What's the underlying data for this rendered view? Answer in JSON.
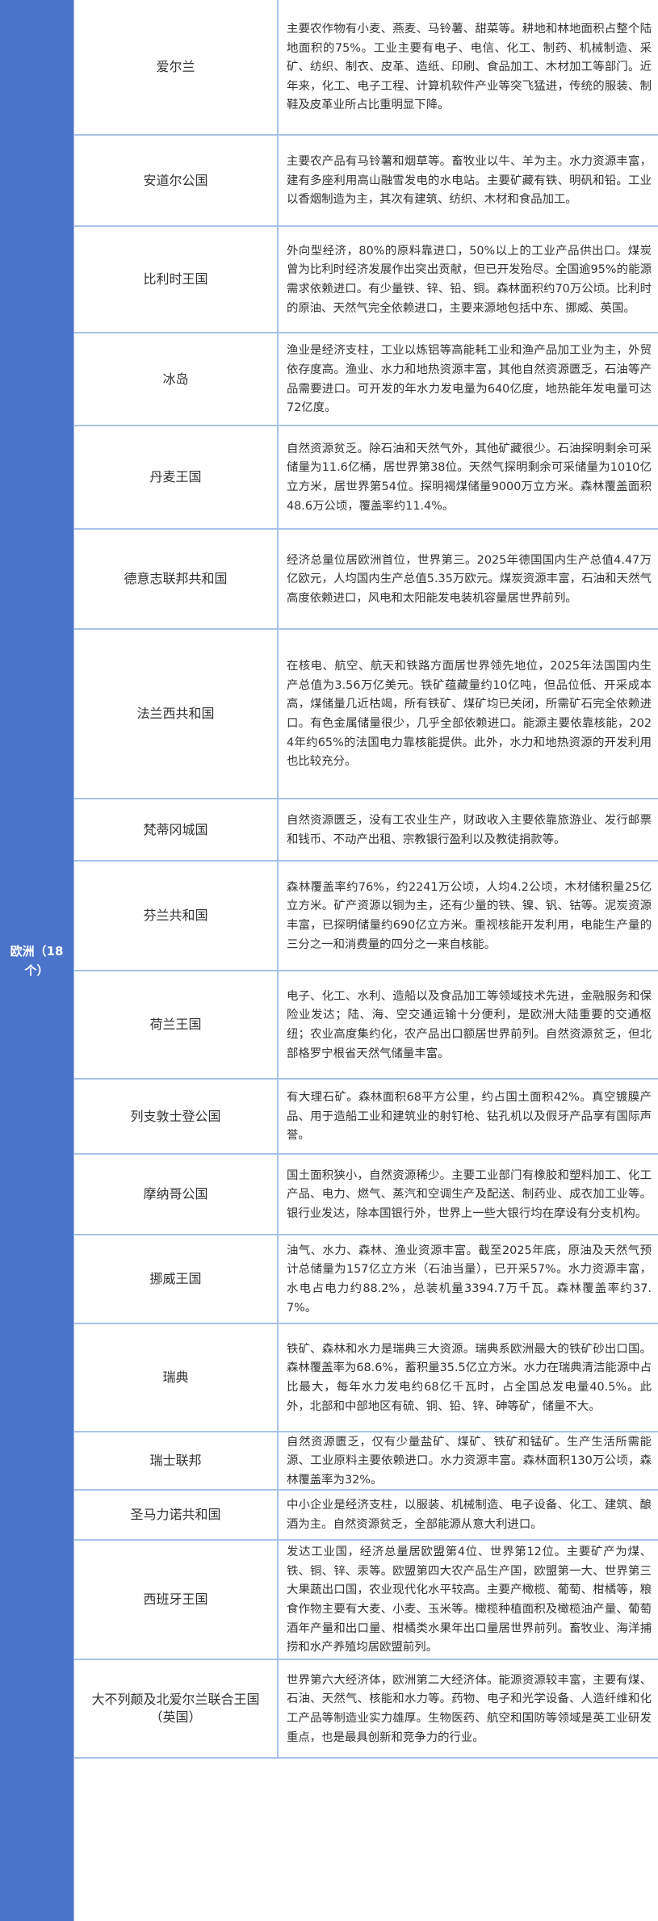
{
  "region_label": "欧洲（18个）",
  "countries": [
    {
      "name": "爱尔兰",
      "desc": "主要农作物有小麦、燕麦、马铃薯、甜菜等。耕地和林地面积占整个陆地面积的75%。工业主要有电子、电信、化工、制药、机械制造、采矿、纺织、制衣、皮革、造纸、印刷、食品加工、木材加工等部门。近年来，化工、电子工程、计算机软件产业等突飞猛进，传统的服装、制鞋及皮革业所占比重明显下降。"
    },
    {
      "name": "安道尔公国",
      "desc": "主要农产品有马铃薯和烟草等。畜牧业以牛、羊为主。水力资源丰富，建有多座利用高山融雪发电的水电站。主要矿藏有铁、明矾和铅。工业以香烟制造为主，其次有建筑、纺织、木材和食品加工。"
    },
    {
      "name": "比利时王国",
      "desc": "外向型经济，80%的原料靠进口，50%以上的工业产品供出口。煤炭曾为比利时经济发展作出突出贡献，但已开发殆尽。全国逾95%的能源需求依赖进口。有少量铁、锌、铅、铜。森林面积约70万公顷。比利时的原油、天然气完全依赖进口，主要来源地包括中东、挪威、英国。"
    },
    {
      "name": "冰岛",
      "desc": "渔业是经济支柱，工业以炼铝等高能耗工业和渔产品加工业为主，外贸依存度高。渔业、水力和地热资源丰富，其他自然资源匮乏，石油等产品需要进口。可开发的年水力发电量为640亿度，地热能年发电量可达72亿度。"
    },
    {
      "name": "丹麦王国",
      "desc": "自然资源贫乏。除石油和天然气外，其他矿藏很少。石油探明剩余可采储量为11.6亿桶，居世界第38位。天然气探明剩余可采储量为1010亿立方米，居世界第54位。探明褐煤储量9000万立方米。森林覆盖面积48.6万公顷，覆盖率约11.4%。"
    },
    {
      "name": "德意志联邦共和国",
      "desc": "经济总量位居欧洲首位，世界第三。2025年德国国内生产总值4.47万亿欧元，人均国内生产总值5.35万欧元。煤炭资源丰富，石油和天然气高度依赖进口，风电和太阳能发电装机容量居世界前列。"
    },
    {
      "name": "法兰西共和国",
      "desc": "在核电、航空、航天和铁路方面居世界领先地位，2025年法国国内生产总值为3.56万亿美元。铁矿蕴藏量约10亿吨，但品位低、开采成本高，煤储量几近枯竭，所有铁矿、煤矿均已关闭，所需矿石完全依赖进口。有色金属储量很少，几乎全部依赖进口。能源主要依靠核能，2024年约65%的法国电力靠核能提供。此外，水力和地热资源的开发利用也比较充分。"
    },
    {
      "name": "梵蒂冈城国",
      "desc": "自然资源匮乏，没有工农业生产，财政收入主要依靠旅游业、发行邮票和钱币、不动产出租、宗教银行盈利以及教徒捐款等。"
    },
    {
      "name": "芬兰共和国",
      "desc": "森林覆盖率约76%，约2241万公顷，人均4.2公顷，木材储积量25亿立方米。矿产资源以铜为主，还有少量的铁、镍、钒、钴等。泥炭资源丰富，已探明储量约690亿立方米。重视核能开发利用，电能生产量的三分之一和消费量的四分之一来自核能。"
    },
    {
      "name": "荷兰王国",
      "desc": "电子、化工、水利、造船以及食品加工等领域技术先进，金融服务和保险业发达；陆、海、空交通运输十分便利，是欧洲大陆重要的交通枢纽；农业高度集约化，农产品出口额居世界前列。自然资源贫乏，但北部格罗宁根省天然气储量丰富。"
    },
    {
      "name": "列支敦士登公国",
      "desc": "有大理石矿。森林面积68平方公里，约占国土面积42%。真空镀膜产品、用于造船工业和建筑业的射钉枪、钻孔机以及假牙产品享有国际声誉。"
    },
    {
      "name": "摩纳哥公国",
      "desc": "国土面积狭小，自然资源稀少。主要工业部门有橡胶和塑料加工、化工产品、电力、燃气、蒸汽和空调生产及配送、制药业、成衣加工业等。银行业发达，除本国银行外，世界上一些大银行均在摩设有分支机构。"
    },
    {
      "name": "挪威王国",
      "desc": "油气、水力、森林、渔业资源丰富。截至2025年底，原油及天然气预计总储量为157亿立方米（石油当量），已开采57%。水力资源丰富，水电占电力约88.2%，总装机量3394.7万千瓦。森林覆盖率约37.7%。"
    },
    {
      "name": "瑞典",
      "desc": "铁矿、森林和水力是瑞典三大资源。瑞典系欧洲最大的铁矿砂出口国。森林覆盖率为68.6%，蓄积量35.5亿立方米。水力在瑞典清洁能源中占比最大，每年水力发电约68亿千瓦时，占全国总发电量40.5%。此外，北部和中部地区有硫、铜、铅、锌、砷等矿，储量不大。"
    },
    {
      "name": "瑞士联邦",
      "desc": "自然资源匮乏，仅有少量盐矿、煤矿、铁矿和锰矿。生产生活所需能源、工业原料主要依赖进口。水力资源丰富。森林面积130万公顷，森林覆盖率为32%。"
    },
    {
      "name": "圣马力诺共和国",
      "desc": "中小企业是经济支柱，以服装、机械制造、电子设备、化工、建筑、酿酒为主。自然资源贫乏，全部能源从意大利进口。"
    },
    {
      "name": "西班牙王国",
      "desc": "发达工业国，经济总量居欧盟第4位、世界第12位。主要矿产为煤、铁、铜、锌、汞等。欧盟第四大农产品生产国，欧盟第一大、世界第三大果蔬出口国，农业现代化水平较高。主要产橄榄、葡萄、柑橘等，粮食作物主要有大麦、小麦、玉米等。橄榄种植面积及橄榄油产量、葡萄酒年产量和出口量、柑橘类水果年出口量居世界前列。畜牧业、海洋捕捞和水产养殖均居欧盟前列。"
    },
    {
      "name": "大不列颠及北爱尔兰联合王国（英国）",
      "desc": "世界第六大经济体，欧洲第二大经济体。能源资源较丰富，主要有煤、石油、天然气、核能和水力等。药物、电子和光学设备、人造纤维和化工产品等制造业实力雄厚。生物医药、航空和国防等领域是英工业研发重点，也是最具创新和竞争力的行业。"
    }
  ]
}
